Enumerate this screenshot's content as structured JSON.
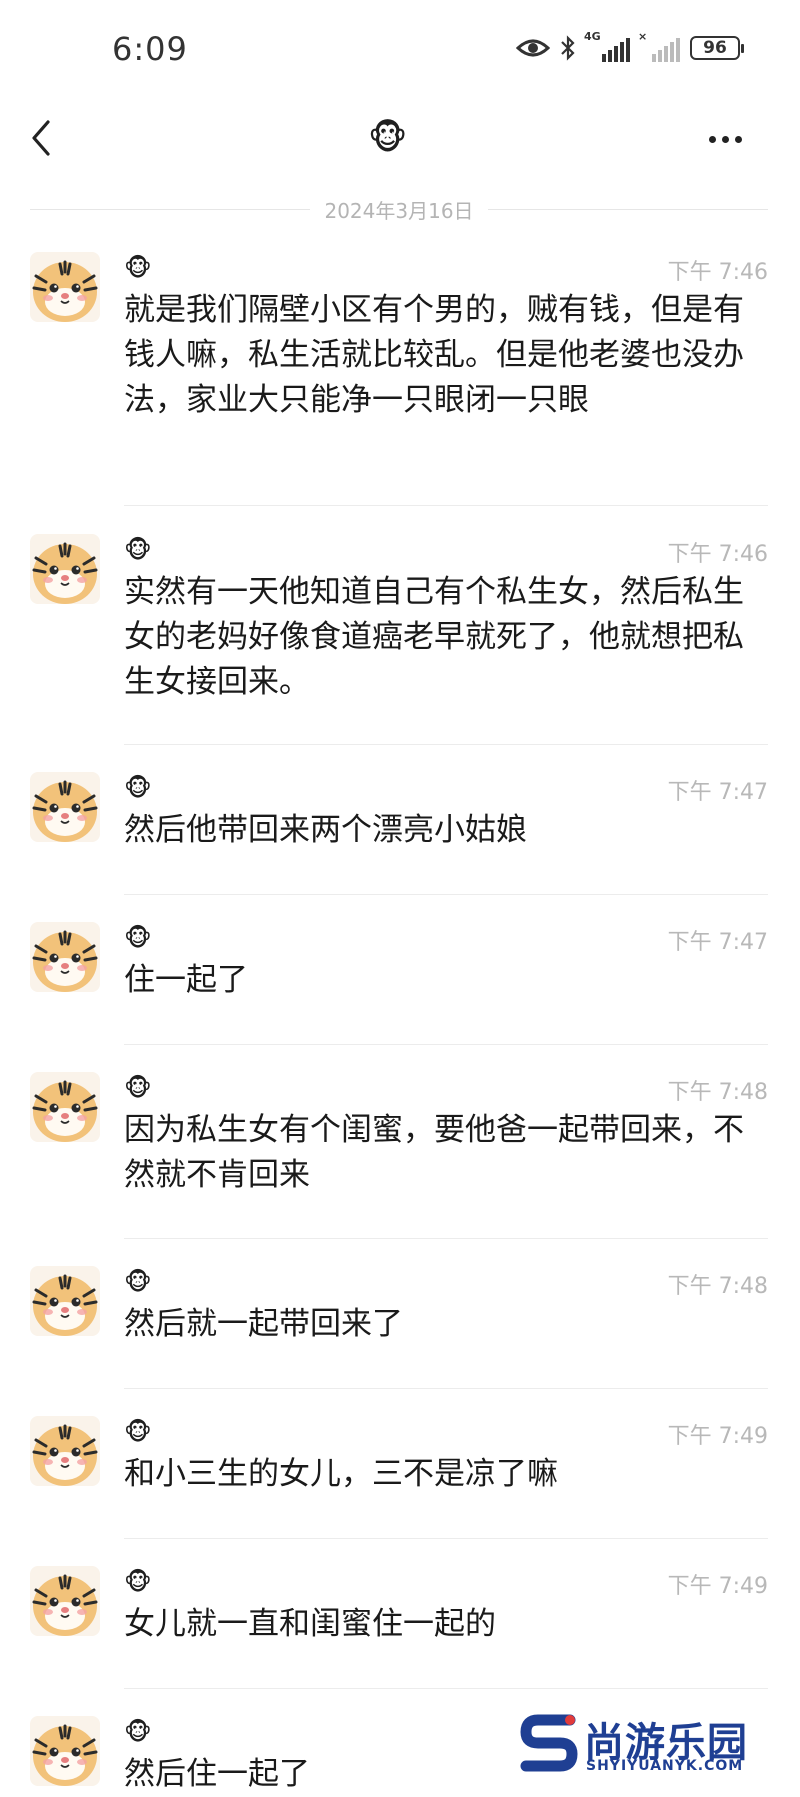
{
  "status_bar": {
    "time": "6:09",
    "network_label": "4G",
    "battery": "96",
    "icons": [
      "eye-icon",
      "bluetooth-icon",
      "signal-4g-icon",
      "signal-nosim-icon",
      "battery-icon"
    ]
  },
  "nav": {
    "back_icon": "chevron-left-icon",
    "title": "🐵",
    "more_icon": "more-horizontal-icon"
  },
  "date_divider": "2024年3月16日",
  "messages": [
    {
      "sender": "🐵",
      "time": "下午 7:46",
      "text": "就是我们隔壁小区有个男的，贼有钱，但是有钱人嘛，私生活就比较乱。但是他老婆也没办法，家业大只能净一只眼闭一只眼"
    },
    {
      "sender": "🐵",
      "time": "下午 7:46",
      "text": "实然有一天他知道自己有个私生女，然后私生女的老妈好像食道癌老早就死了，他就想把私生女接回来。"
    },
    {
      "sender": "🐵",
      "time": "下午 7:47",
      "text": "然后他带回来两个漂亮小姑娘"
    },
    {
      "sender": "🐵",
      "time": "下午 7:47",
      "text": "住一起了"
    },
    {
      "sender": "🐵",
      "time": "下午 7:48",
      "text": "因为私生女有个闺蜜，要他爸一起带回来，不然就不肯回来"
    },
    {
      "sender": "🐵",
      "time": "下午 7:48",
      "text": "然后就一起带回来了"
    },
    {
      "sender": "🐵",
      "time": "下午 7:49",
      "text": "和小三生的女儿，三不是凉了嘛"
    },
    {
      "sender": "🐵",
      "time": "下午 7:49",
      "text": "女儿就一直和闺蜜住一起的"
    },
    {
      "sender": "🐵",
      "time": "",
      "text": "然后住一起了"
    }
  ],
  "avatar_icon": "tiger-avatar-icon",
  "watermark": {
    "cn": "尚游乐园",
    "en": "SHYIYUANYK.COM",
    "color": "#1f3f93"
  }
}
